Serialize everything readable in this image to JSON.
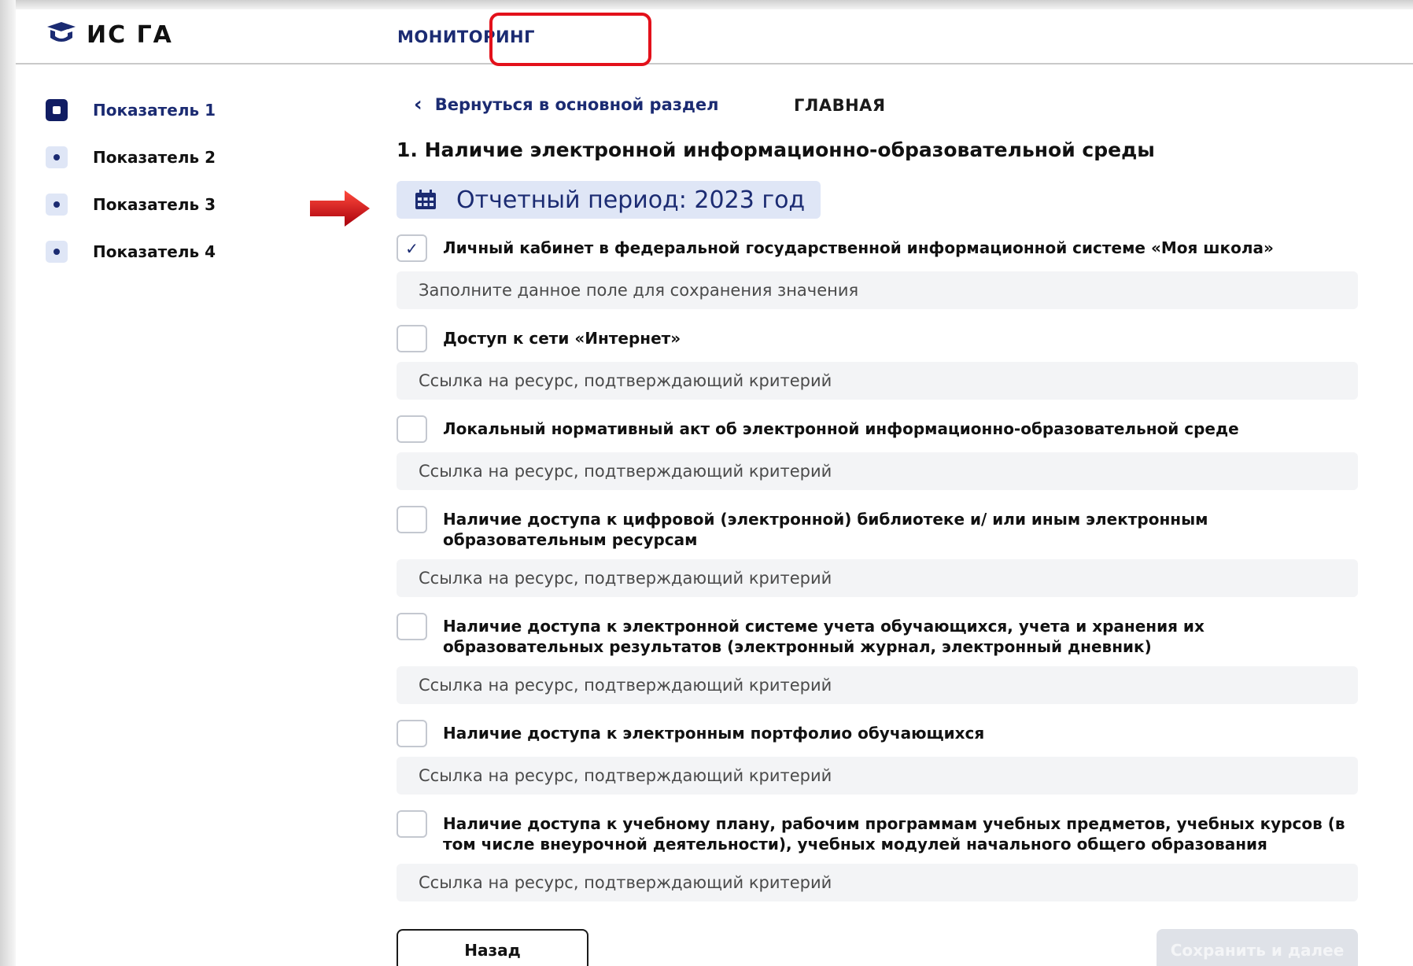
{
  "header": {
    "logo_text": "ИС ГА",
    "nav": {
      "main": "ГЛАВНАЯ",
      "monitoring": "МОНИТОРИНГ"
    }
  },
  "sidebar": {
    "items": [
      {
        "label": "Показатель 1",
        "active": true
      },
      {
        "label": "Показатель 2",
        "active": false
      },
      {
        "label": "Показатель 3",
        "active": false
      },
      {
        "label": "Показатель 4",
        "active": false
      }
    ]
  },
  "main": {
    "back_link": "Вернуться в основной раздел",
    "section_title": "1. Наличие электронной информационно-образовательной среды",
    "period": "Отчетный период: 2023 год",
    "criteria": [
      {
        "label": "Личный кабинет в федеральной государственной информационной системе «Моя школа»",
        "checked": true,
        "placeholder": "Заполните данное поле для сохранения значения"
      },
      {
        "label": "Доступ к сети «Интернет»",
        "checked": false,
        "placeholder": "Ссылка на ресурс, подтверждающий критерий"
      },
      {
        "label": "Локальный нормативный акт об электронной информационно-образовательной среде",
        "checked": false,
        "placeholder": "Ссылка на ресурс, подтверждающий критерий"
      },
      {
        "label": "Наличие доступа к цифровой (электронной) библиотеке и/ или иным электронным образовательным ресурсам",
        "checked": false,
        "placeholder": "Ссылка на ресурс, подтверждающий критерий"
      },
      {
        "label": "Наличие доступа к электронной системе учета обучающихся, учета и хранения их образовательных результатов (электронный журнал, электронный дневник)",
        "checked": false,
        "placeholder": "Ссылка на ресурс, подтверждающий критерий"
      },
      {
        "label": "Наличие доступа к электронным портфолио обучающихся",
        "checked": false,
        "placeholder": "Ссылка на ресурс, подтверждающий критерий"
      },
      {
        "label": "Наличие доступа к учебному плану, рабочим программам учебных предметов, учебных курсов (в том числе внеурочной деятельности), учебных модулей начального общего образования",
        "checked": false,
        "placeholder": "Ссылка на ресурс, подтверждающий критерий"
      }
    ]
  },
  "actions": {
    "back": "Назад",
    "save_next": "Сохранить и далее"
  },
  "colors": {
    "brand": "#1b2b72",
    "highlight": "#e3111b",
    "input_bg": "#f3f4f6",
    "period_bg": "#dfe6f6"
  }
}
